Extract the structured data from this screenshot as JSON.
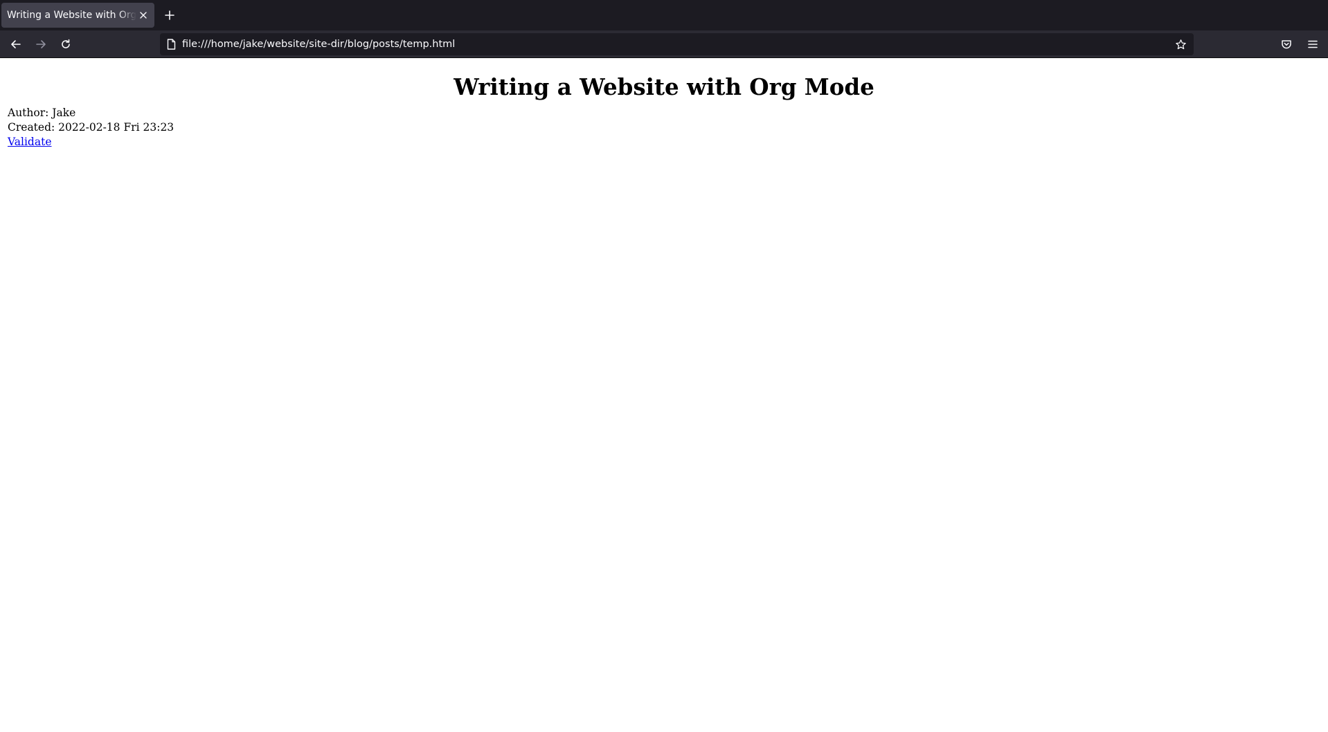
{
  "browser": {
    "tab": {
      "title": "Writing a Website with Org Mode"
    },
    "url": "file:///home/jake/website/site-dir/blog/posts/temp.html",
    "icons": {
      "close": "close-icon",
      "new_tab": "plus-icon",
      "back": "arrow-left-icon",
      "forward": "arrow-right-icon",
      "reload": "reload-icon",
      "page": "page-icon",
      "bookmark": "star-icon",
      "pocket": "pocket-icon",
      "menu": "hamburger-menu-icon"
    }
  },
  "page": {
    "title": "Writing a Website with Org Mode",
    "author_line": "Author: Jake",
    "created_line": "Created: 2022-02-18 Fri 23:23",
    "validate_link": "Validate"
  },
  "colors": {
    "chrome_bg": "#1c1b22",
    "toolbar_bg": "#2b2a33",
    "tab_active": "#42414d",
    "link": "#0000ee"
  }
}
